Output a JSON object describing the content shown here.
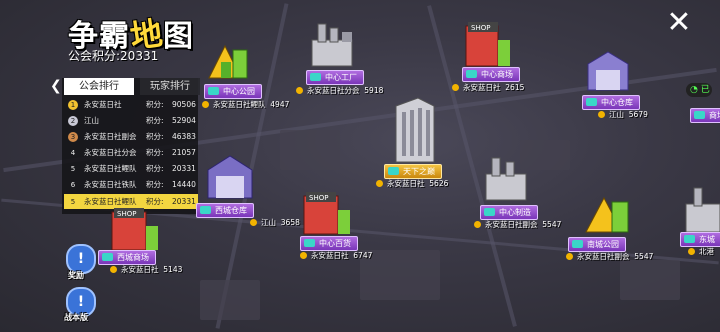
{
  "header": {
    "title_a": "争霸",
    "title_b": "地",
    "title_c": "图",
    "points_label": "公会积分:",
    "points_value": "20331",
    "close_icon": "close-icon"
  },
  "rank_panel": {
    "tab_guild": "公会排行",
    "tab_player": "玩家排行",
    "score_label": "积分:",
    "rows": [
      {
        "rank": "1",
        "name": "永安蓝日社",
        "score": "90506",
        "color": "#f2c230"
      },
      {
        "rank": "2",
        "name": "江山",
        "score": "52904",
        "color": "#c9c9d6"
      },
      {
        "rank": "3",
        "name": "永安蓝日社副会",
        "score": "46383",
        "color": "#d08a4a"
      },
      {
        "rank": "4",
        "name": "永安蓝日社分会",
        "score": "21057",
        "color": ""
      },
      {
        "rank": "5",
        "name": "永安蓝日社鲤队",
        "score": "20331",
        "color": ""
      },
      {
        "rank": "6",
        "name": "永安蓝日社铁队",
        "score": "14440",
        "color": ""
      }
    ],
    "my_row": {
      "rank": "5",
      "name": "永安蓝日社鲤队",
      "score_label": "积分:",
      "score": "20331"
    }
  },
  "nodes": [
    {
      "name": "中心公园",
      "owner": "永安蓝日社鲤队",
      "score": "4947"
    },
    {
      "name": "中心工厂",
      "owner": "永安蓝日社分会",
      "score": "5918"
    },
    {
      "name": "中心商场",
      "owner": "永安蓝日社",
      "score": "2615"
    },
    {
      "name": "中心仓库",
      "owner": "江山",
      "score": "5679"
    },
    {
      "name": "天下之巅",
      "owner": "永安蓝日社",
      "score": "5626"
    },
    {
      "name": "西城仓库",
      "owner": "江山",
      "score": "3658"
    },
    {
      "name": "中心制造",
      "owner": "永安蓝日社副会",
      "score": "5547"
    },
    {
      "name": "中心百货",
      "owner": "永安蓝日社",
      "score": "6747"
    },
    {
      "name": "西城商场",
      "owner": "永安蓝日社",
      "score": "5143"
    },
    {
      "name": "南城公园",
      "owner": "永安蓝日社副会",
      "score": "5547"
    },
    {
      "name": "东城",
      "owner": "北港",
      "score": ""
    },
    {
      "name": "商场",
      "owner": "",
      "score": ""
    }
  ],
  "side_buttons": {
    "reward_label": "奖励",
    "report_label": "战本版"
  },
  "timer_text": "已"
}
